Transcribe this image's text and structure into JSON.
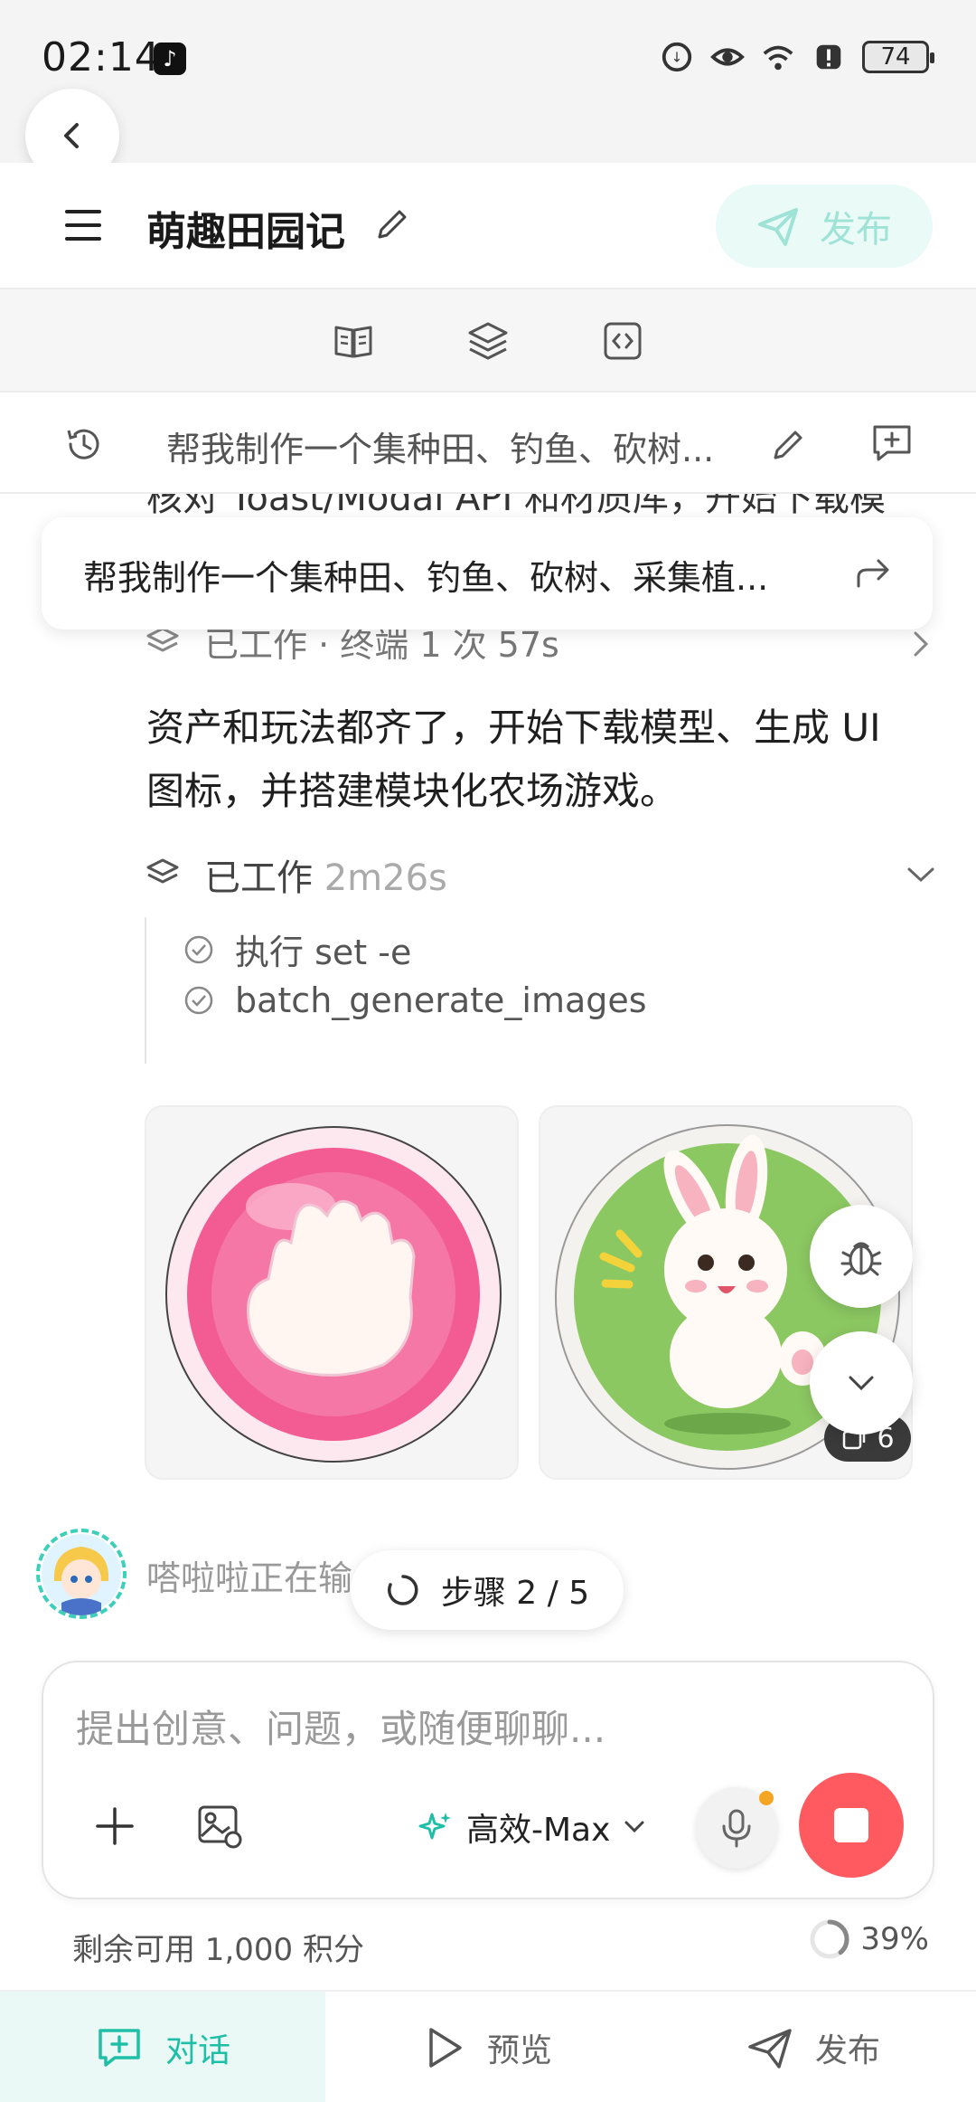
{
  "status_bar": {
    "time": "02:14",
    "battery": "74"
  },
  "header": {
    "title": "萌趣田园记",
    "publish_label": "发布"
  },
  "prompt_bar": {
    "text": "帮我制作一个集种田、钓鱼、砍树..."
  },
  "chat": {
    "cut_off_text": "核对 Toast/Modal API 和材质库，开始下载模",
    "floating_prompt": "帮我制作一个集种田、钓鱼、砍树、采集植...",
    "worked_summary": "已工作 · 终端 1 次 57s",
    "message": "资产和玩法都齐了，开始下载模型、生成 UI 图标，并搭建模块化农场游戏。",
    "worked2_label": "已工作",
    "worked2_time": "2m26s",
    "steps": [
      "执行 set -e",
      "batch_generate_images"
    ],
    "image_count": "6",
    "agent_status": "嗒啦啦正在输",
    "step_progress": "步骤 2 / 5"
  },
  "input": {
    "placeholder": "提出创意、问题，或随便聊聊...",
    "model": "高效-Max"
  },
  "footer": {
    "credits": "剩余可用 1,000 积分",
    "progress_label": "39%",
    "progress_value": 0.39
  },
  "nav": {
    "chat": "对话",
    "preview": "预览",
    "publish": "发布"
  },
  "colors": {
    "accent": "#1fbfa7",
    "stop": "#ff5a5f",
    "pink_button": "#f25c93",
    "bunny_green": "#8cc862"
  }
}
